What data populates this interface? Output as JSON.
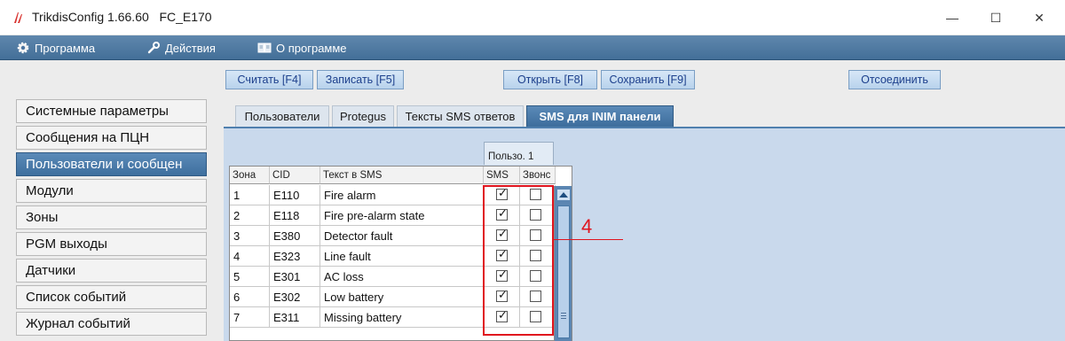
{
  "window": {
    "title": "TrikdisConfig 1.66.60   FC_E170",
    "minimize": "—",
    "maximize": "☐",
    "close": "✕"
  },
  "menu": [
    {
      "label": "Программа",
      "icon": "gear-icon"
    },
    {
      "label": "Действия",
      "icon": "wrench-icon"
    },
    {
      "label": "О программе",
      "icon": "book-icon"
    }
  ],
  "toolbar": {
    "read": "Считать [F4]",
    "write": "Записать [F5]",
    "open": "Открыть [F8]",
    "save": "Сохранить [F9]",
    "disconnect": "Отсоединить"
  },
  "nav": [
    "Системные параметры",
    "Сообщения на ПЦН",
    "Пользователи и сообщен",
    "Модули",
    "Зоны",
    "PGM выходы",
    "Датчики",
    "Список событий",
    "Журнал событий"
  ],
  "nav_active_index": 2,
  "tabs": [
    "Пользователи",
    "Protegus",
    "Тексты SMS ответов",
    "SMS для INIM панели"
  ],
  "tabs_active_index": 3,
  "grid": {
    "group_header": "Пользо. 1",
    "headers": [
      "Зона",
      "CID",
      "Текст в SMS",
      "SMS",
      "Звонс"
    ],
    "rows": [
      {
        "zone": "1",
        "cid": "E110",
        "text": "Fire alarm",
        "sms": true,
        "call": false
      },
      {
        "zone": "2",
        "cid": "E118",
        "text": "Fire pre-alarm state",
        "sms": true,
        "call": false
      },
      {
        "zone": "3",
        "cid": "E380",
        "text": "Detector fault",
        "sms": true,
        "call": false
      },
      {
        "zone": "4",
        "cid": "E323",
        "text": "Line fault",
        "sms": true,
        "call": false
      },
      {
        "zone": "5",
        "cid": "E301",
        "text": "AC loss",
        "sms": true,
        "call": false
      },
      {
        "zone": "6",
        "cid": "E302",
        "text": "Low battery",
        "sms": true,
        "call": false
      },
      {
        "zone": "7",
        "cid": "E311",
        "text": "Missing battery",
        "sms": true,
        "call": false
      }
    ]
  },
  "annotation": {
    "number": "4",
    "color": "#e0141e"
  },
  "colors": {
    "menubar": "#4f7aa3",
    "accent": "#3e6f9e",
    "panel": "#c9d9ec"
  }
}
